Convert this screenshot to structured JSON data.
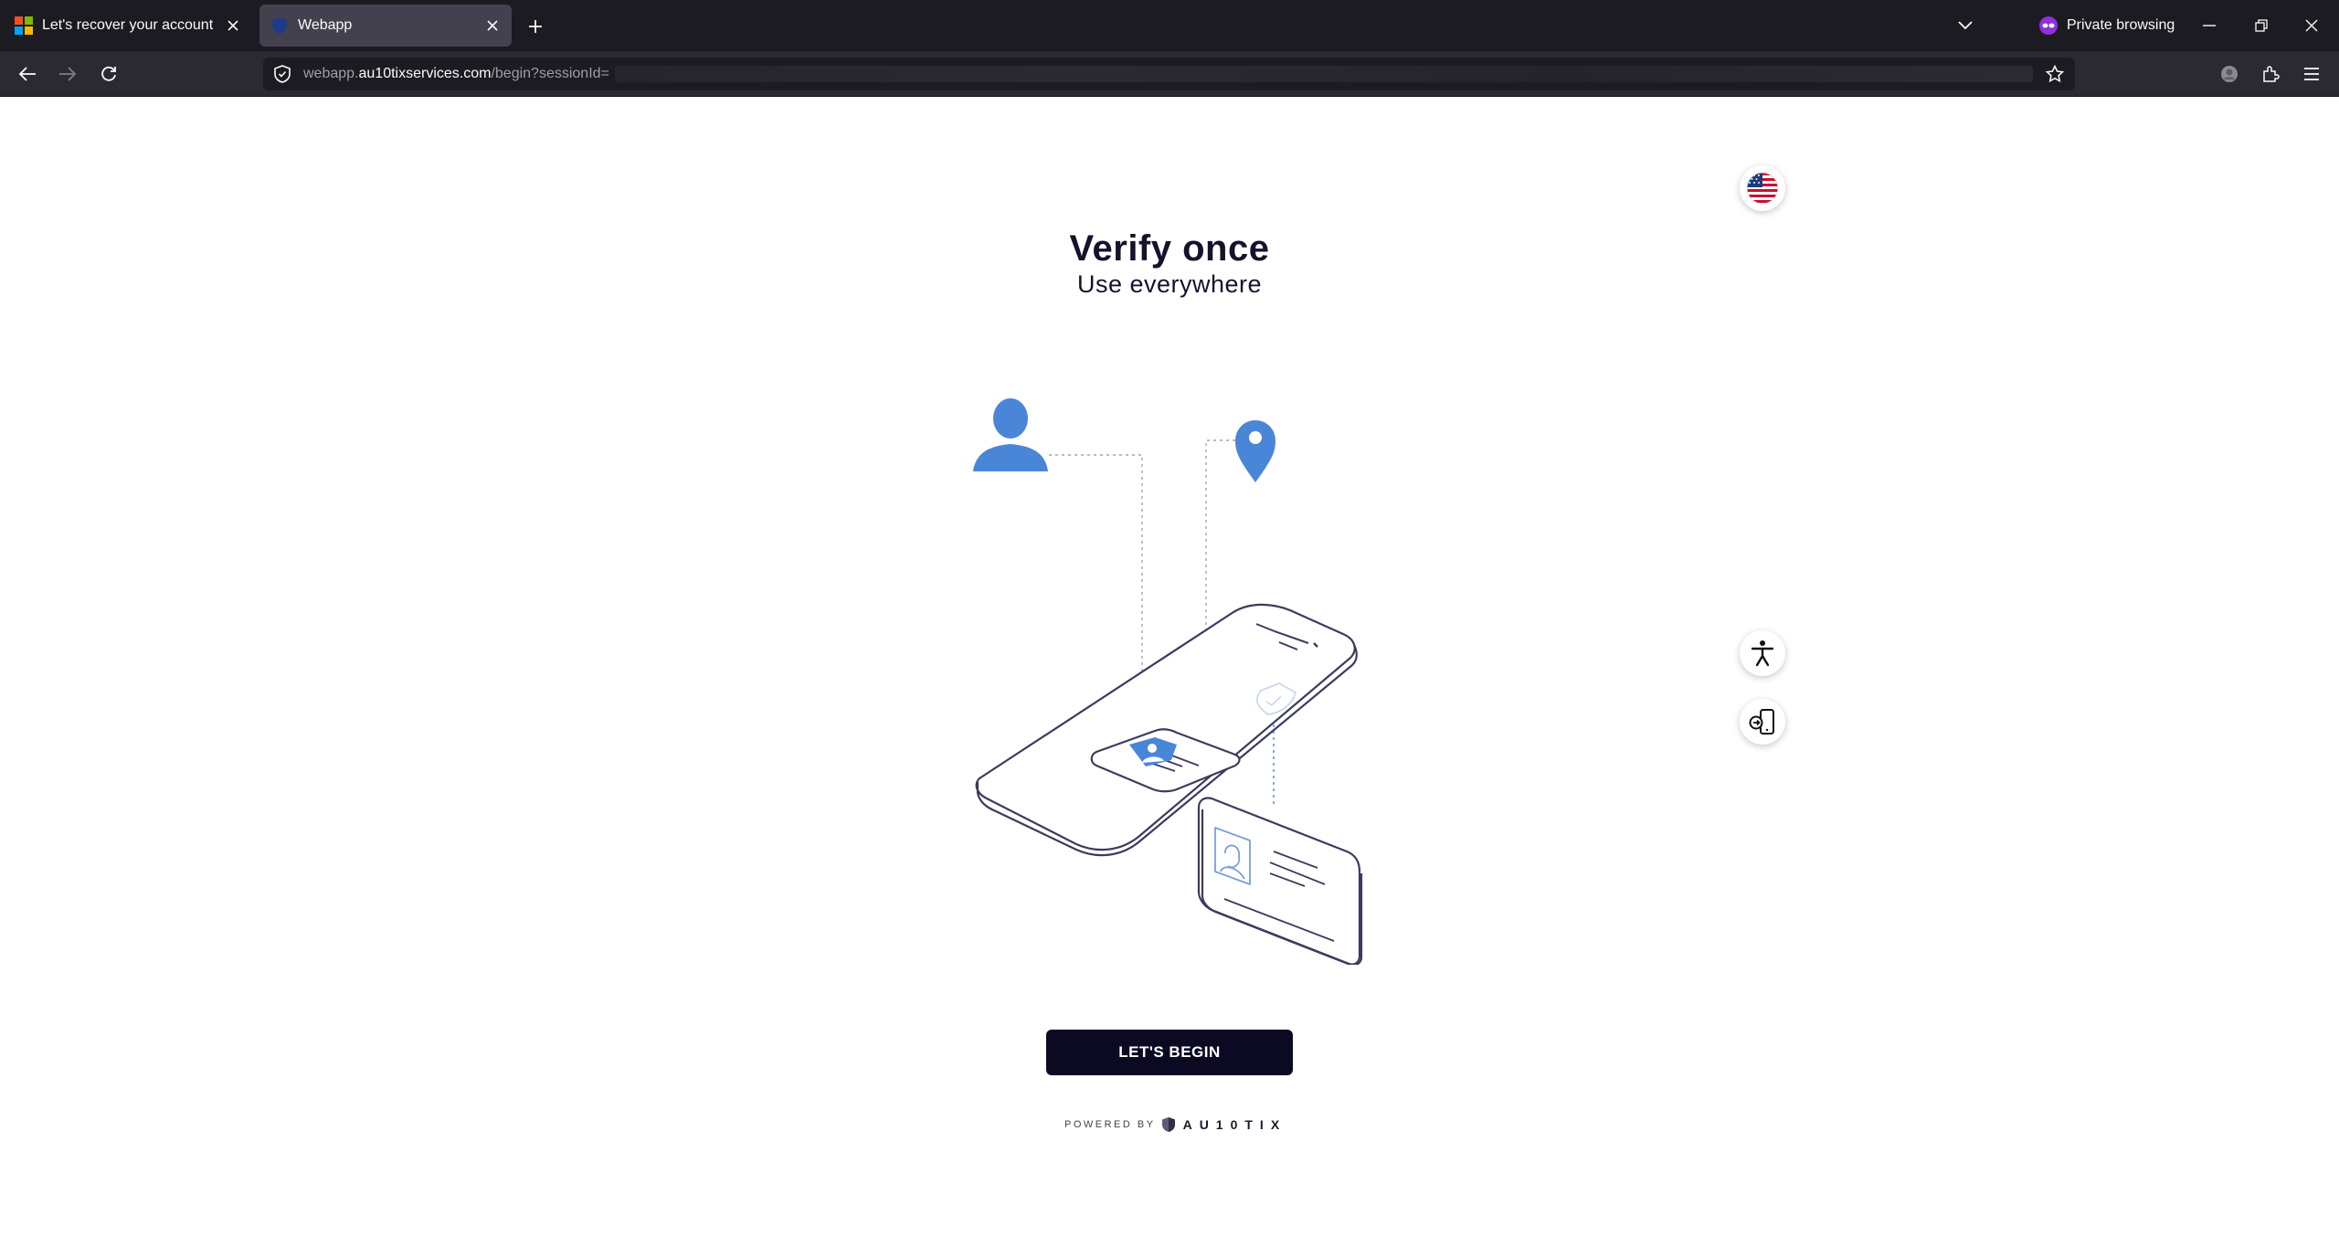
{
  "browser": {
    "tabs": [
      {
        "title": "Let's recover your account",
        "favicon": "microsoft-logo-icon",
        "active": false
      },
      {
        "title": "Webapp",
        "favicon": "shield-icon",
        "active": true
      }
    ],
    "private_label": "Private browsing",
    "url": {
      "prefix": "webapp.",
      "domain": "au10tixservices.com",
      "path": "/begin?sessionId="
    }
  },
  "page": {
    "heading": "Verify once",
    "subheading": "Use everywhere",
    "begin_button": "LET'S BEGIN",
    "powered_by": "POWERED BY",
    "brand": "AU10TIX",
    "language_flag": "us-flag-icon",
    "colors": {
      "accent_blue": "#4a86d8",
      "button_bg": "#0b0a22",
      "heading": "#14132b",
      "outline": "#3d3b5c"
    }
  }
}
